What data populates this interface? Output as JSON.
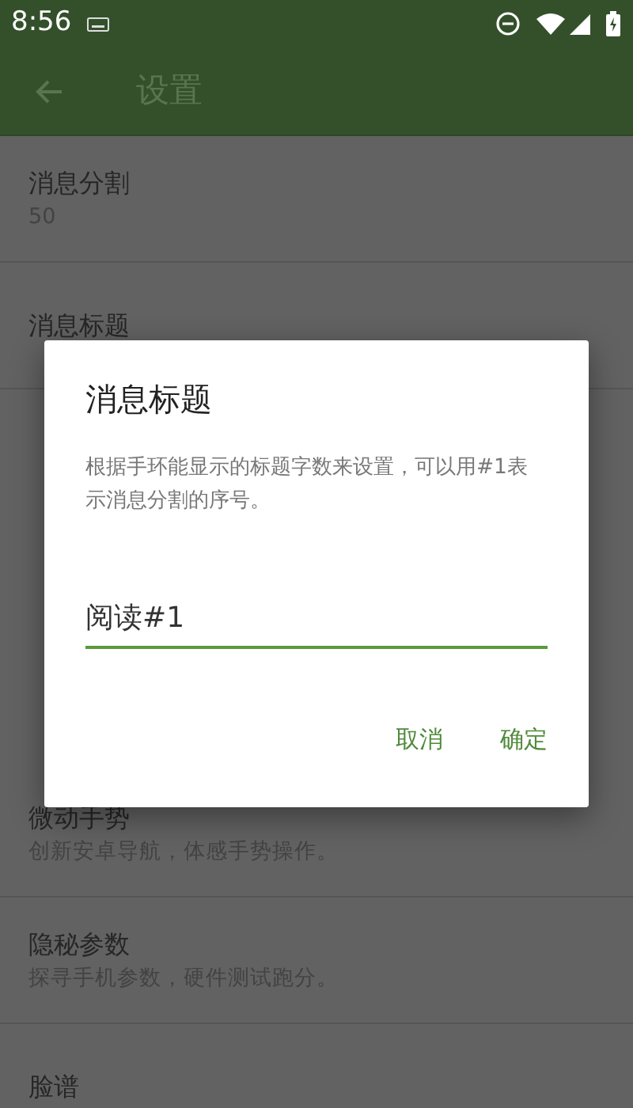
{
  "status_bar": {
    "time": "8:56"
  },
  "toolbar": {
    "title": "设置"
  },
  "settings_top": [
    {
      "title": "消息分割",
      "summary": "50"
    },
    {
      "title": "消息标题"
    }
  ],
  "settings_bottom": [
    {
      "title": "微动手势",
      "summary": "创新安卓导航，体感手势操作。"
    },
    {
      "title": "隐秘参数",
      "summary": "探寻手机参数，硬件测试跑分。"
    },
    {
      "title": "脸谱"
    }
  ],
  "dialog": {
    "title": "消息标题",
    "message": "根据手环能显示的标题字数来设置，可以用#1表示消息分割的序号。",
    "value": "阅读#1",
    "buttons": [
      "取消",
      "确定"
    ]
  }
}
